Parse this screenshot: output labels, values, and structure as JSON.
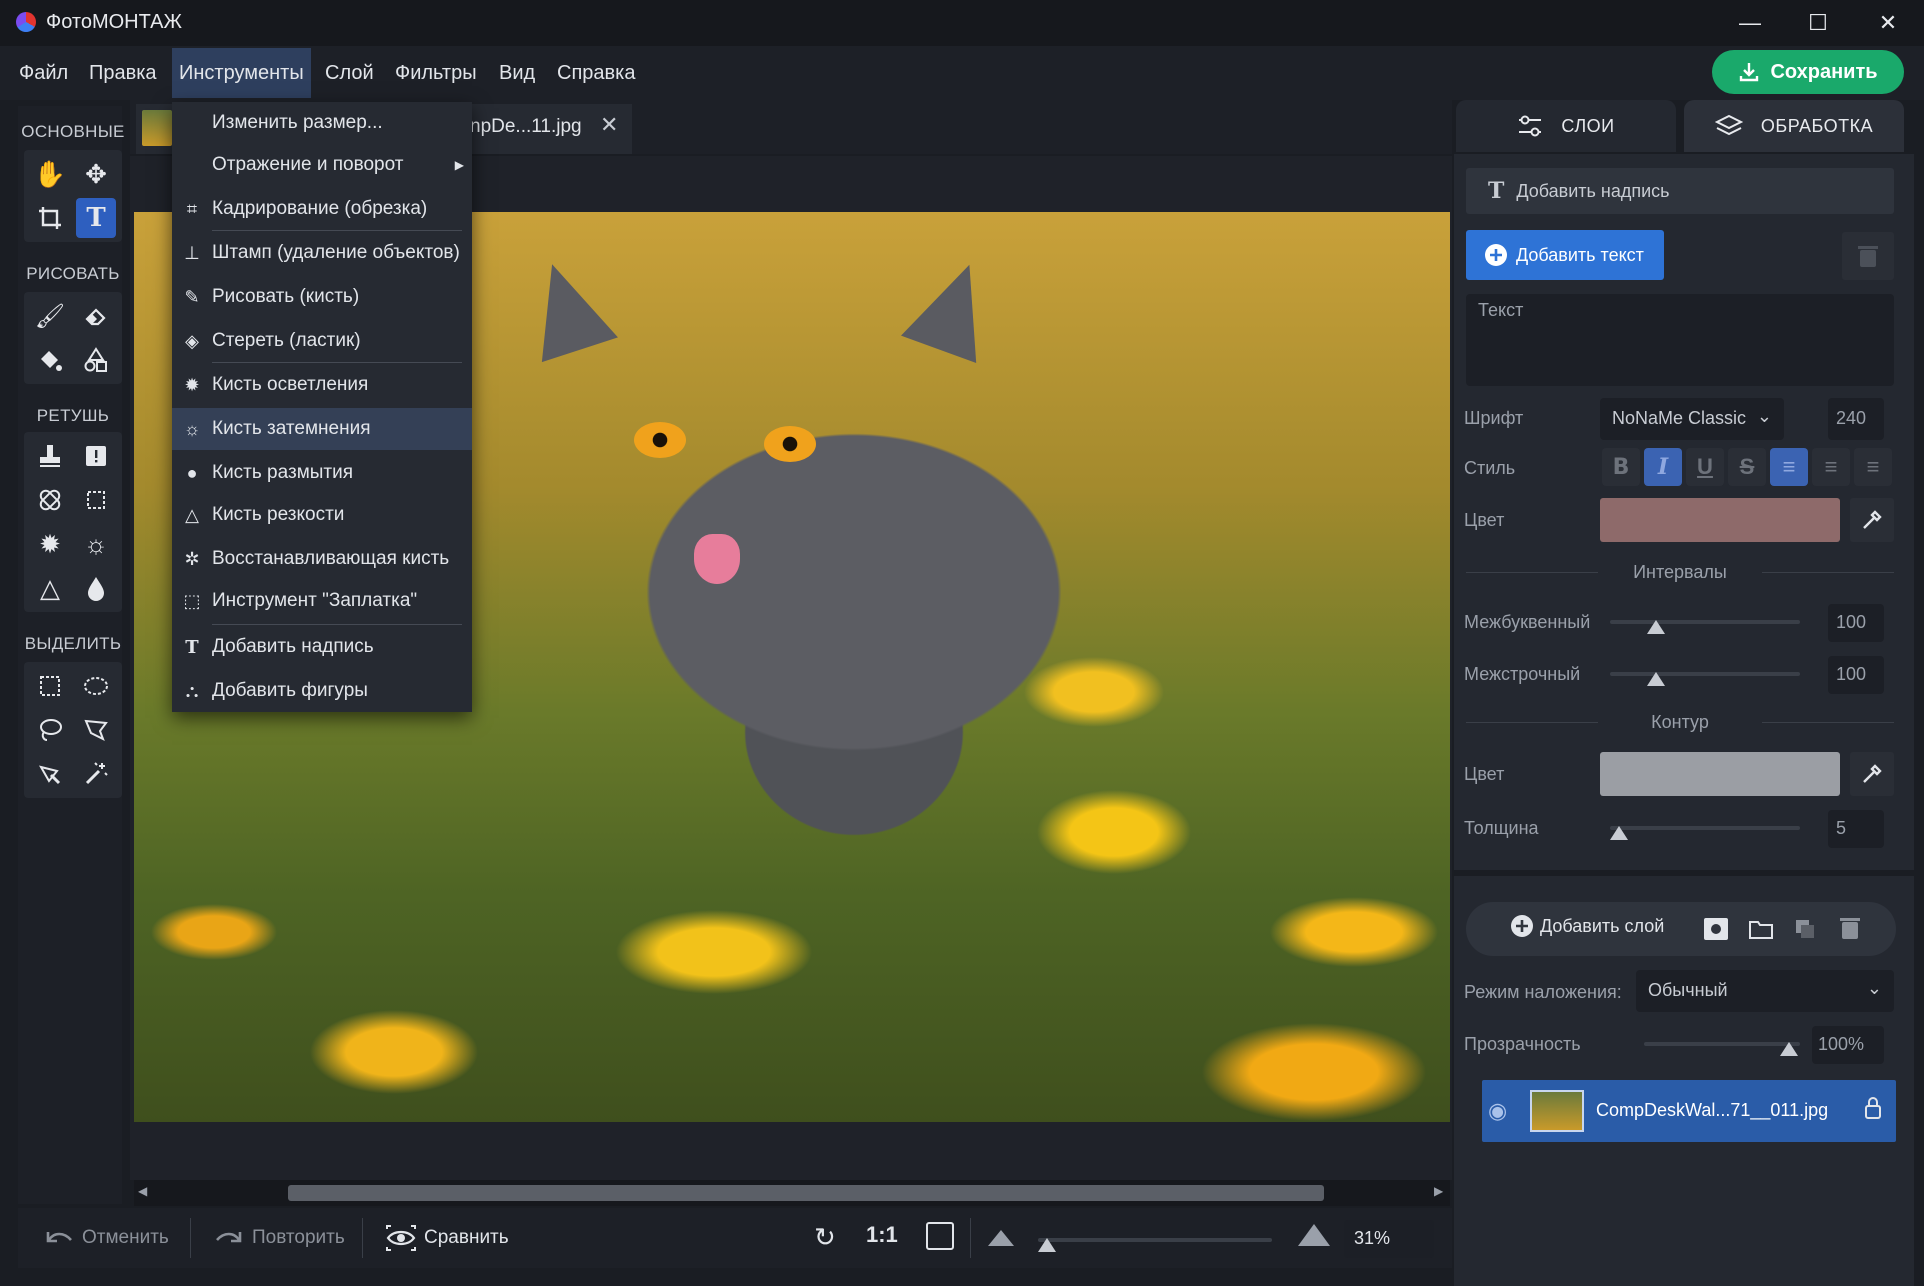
{
  "window": {
    "title": "ФотоМОНТАЖ",
    "min": "—",
    "max": "☐",
    "close": "✕"
  },
  "menu": [
    "Файл",
    "Правка",
    "Инструменты",
    "Слой",
    "Фильтры",
    "Вид",
    "Справка"
  ],
  "save_label": "Сохранить",
  "tool_sections": [
    "ОСНОВНЫЕ",
    "РИСОВАТЬ",
    "РЕТУШЬ",
    "ВЫДЕЛИТЬ"
  ],
  "tab": {
    "title": "npDe...11.jpg",
    "close": "✕"
  },
  "dropdown": [
    "Изменить размер...",
    "Отражение и поворот",
    "Кадрирование (обрезка)",
    "Штамп (удаление объектов)",
    "Рисовать (кисть)",
    "Стереть (ластик)",
    "Кисть осветления",
    "Кисть затемнения",
    "Кисть размытия",
    "Кисть резкости",
    "Восстанавливающая кисть",
    "Инструмент \"Заплатка\"",
    "Добавить надпись",
    "Добавить фигуры"
  ],
  "right_tabs": {
    "layers": "СЛОИ",
    "processing": "ОБРАБОТКА"
  },
  "text_panel": {
    "header": "Добавить надпись",
    "add_text": "Добавить текст",
    "text_placeholder": "Текст",
    "font_label": "Шрифт",
    "font_value": "NoNaMe Classic",
    "font_size": "240",
    "style_label": "Стиль",
    "color_label": "Цвет",
    "fill_color": "#8e6a6a",
    "intervals_title": "Интервалы",
    "letter_label": "Межбуквенный",
    "letter_value": "100",
    "line_label": "Межстрочный",
    "line_value": "100",
    "contour_title": "Контур",
    "contour_color_label": "Цвет",
    "contour_color": "#9b9ea4",
    "thickness_label": "Толщина",
    "thickness_value": "5"
  },
  "layers_panel": {
    "add_layer": "Добавить слой",
    "blend_label": "Режим наложения:",
    "blend_value": "Обычный",
    "opacity_label": "Прозрачность",
    "opacity_value": "100%",
    "layer_name": "CompDeskWal...71__011.jpg"
  },
  "bottom": {
    "undo": "Отменить",
    "redo": "Повторить",
    "compare": "Сравнить",
    "one_to_one": "1:1",
    "zoom": "31%"
  }
}
